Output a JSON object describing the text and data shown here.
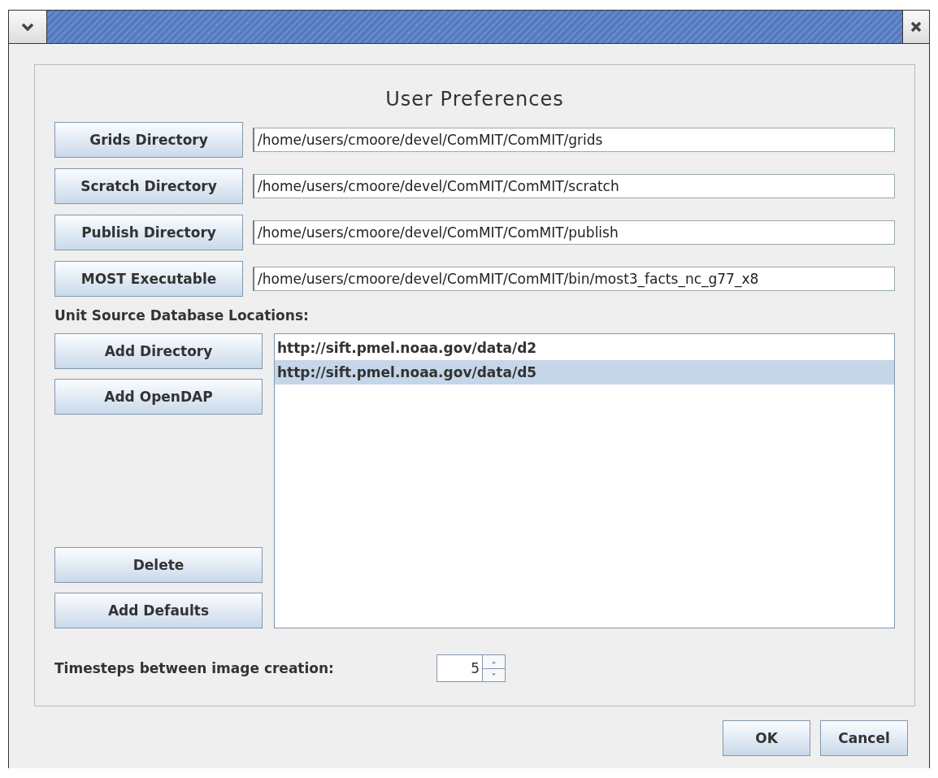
{
  "dialog": {
    "heading": "User Preferences",
    "directories": [
      {
        "button": "Grids Directory",
        "value": "/home/users/cmoore/devel/ComMIT/ComMIT/grids"
      },
      {
        "button": "Scratch Directory",
        "value": "/home/users/cmoore/devel/ComMIT/ComMIT/scratch"
      },
      {
        "button": "Publish Directory",
        "value": "/home/users/cmoore/devel/ComMIT/ComMIT/publish"
      },
      {
        "button": "MOST Executable",
        "value": "/home/users/cmoore/devel/ComMIT/ComMIT/bin/most3_facts_nc_g77_x8"
      }
    ],
    "locations_label": "Unit Source Database Locations:",
    "location_buttons_top": [
      "Add Directory",
      "Add OpenDAP"
    ],
    "location_buttons_bottom": [
      "Delete",
      "Add Defaults"
    ],
    "locations": [
      {
        "url": "http://sift.pmel.noaa.gov/data/d2",
        "selected": false
      },
      {
        "url": "http://sift.pmel.noaa.gov/data/d5",
        "selected": true
      }
    ],
    "timesteps": {
      "label": "Timesteps between image creation:",
      "value": "5"
    }
  },
  "buttons": [
    "OK",
    "Cancel"
  ]
}
